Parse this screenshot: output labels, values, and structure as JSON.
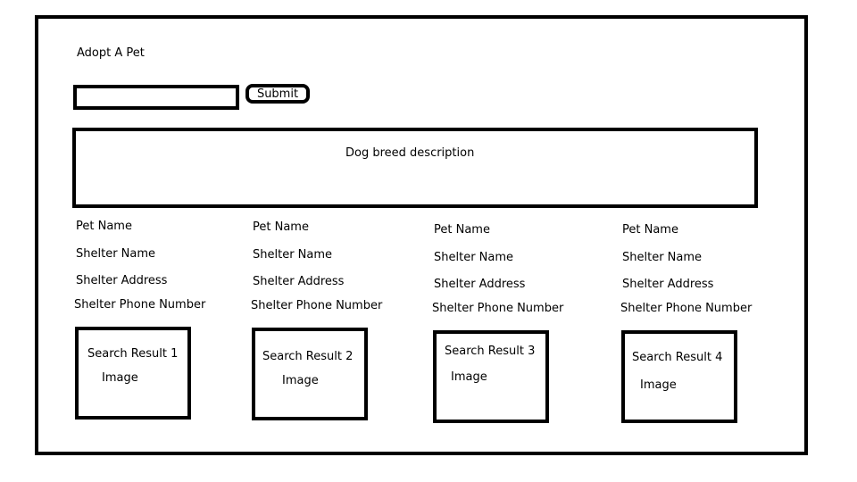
{
  "app": {
    "title": "Adopt A Pet"
  },
  "search": {
    "value": "",
    "placeholder": "",
    "submit_label": "Submit"
  },
  "description": {
    "text": "Dog breed description"
  },
  "results": [
    {
      "pet_name": "Pet Name",
      "shelter_name": "Shelter Name",
      "shelter_address": "Shelter Address",
      "shelter_phone": "Shelter Phone Number",
      "title": "Search Result 1",
      "image_label": "Image"
    },
    {
      "pet_name": "Pet Name",
      "shelter_name": "Shelter Name",
      "shelter_address": "Shelter Address",
      "shelter_phone": "Shelter Phone Number",
      "title": "Search Result 2",
      "image_label": "Image"
    },
    {
      "pet_name": "Pet Name",
      "shelter_name": "Shelter Name",
      "shelter_address": "Shelter Address",
      "shelter_phone": "Shelter Phone Number",
      "title": "Search Result 3",
      "image_label": "Image"
    },
    {
      "pet_name": "Pet Name",
      "shelter_name": "Shelter Name",
      "shelter_address": "Shelter Address",
      "shelter_phone": "Shelter Phone Number",
      "title": "Search Result 4",
      "image_label": "Image"
    }
  ]
}
